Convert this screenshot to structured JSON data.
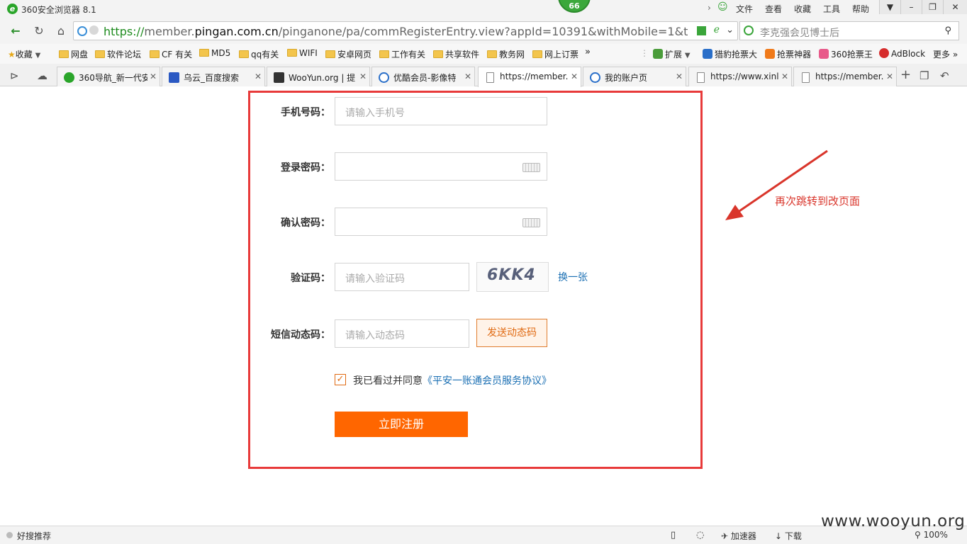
{
  "window": {
    "title": "360安全浏览器 8.1",
    "badge": "66",
    "menus": [
      "文件",
      "查看",
      "收藏",
      "工具",
      "帮助"
    ]
  },
  "address": {
    "url_scheme": "https://",
    "url_sub": "member.",
    "url_domain": "pingan.com.cn",
    "url_path": "/pinganone/pa/commRegisterEntry.view?appId=10391&withMobile=1&timestam",
    "search_text": "李克强会见博士后"
  },
  "bookmarks": {
    "left": [
      {
        "label": "收藏"
      },
      {
        "label": "网盘"
      },
      {
        "label": "软件论坛"
      },
      {
        "label": "CF 有关"
      },
      {
        "label": "MD5"
      },
      {
        "label": "qq有关"
      },
      {
        "label": "WIFI"
      },
      {
        "label": "安卓网页"
      },
      {
        "label": "工作有关"
      },
      {
        "label": "共享软件"
      },
      {
        "label": "教务网"
      },
      {
        "label": "网上订票"
      }
    ],
    "more_left": "»",
    "extensions": "扩展",
    "right": [
      {
        "label": "猎豹抢票大",
        "color": "#2a6fc9"
      },
      {
        "label": "抢票神器",
        "color": "#f07a1a"
      },
      {
        "label": "360抢票王",
        "color": "#e85a8a"
      },
      {
        "label": "AdBlock",
        "color": "#d62c2c"
      }
    ],
    "more_right": "更多"
  },
  "tabs": [
    {
      "label": "360导航_新一代安",
      "color": "#2aa52a"
    },
    {
      "label": "乌云_百度搜索",
      "color": "#2b59c3"
    },
    {
      "label": "WooYun.org | 提",
      "color": "#333333"
    },
    {
      "label": "优酷会员-影像特",
      "color": "#2a6fc9"
    },
    {
      "label": "https://member.",
      "color": "#ffffff"
    },
    {
      "label": "我的账户页",
      "color": "#2a6fc9"
    },
    {
      "label": "https://www.xinl",
      "color": "#ffffff"
    },
    {
      "label": "https://member.",
      "color": "#ffffff"
    }
  ],
  "form": {
    "phone_label": "手机号码：",
    "phone_placeholder": "请输入手机号",
    "password_label": "登录密码：",
    "confirm_label": "确认密码：",
    "captcha_label": "验证码：",
    "captcha_placeholder": "请输入验证码",
    "captcha_text": "6KK4",
    "captcha_refresh": "换一张",
    "sms_label": "短信动态码：",
    "sms_placeholder": "请输入动态码",
    "sms_button": "发送动态码",
    "agree_prefix": "我已看过并同意",
    "agree_link": "《平安一账通会员服务协议》",
    "agree_checked": true,
    "submit": "立即注册"
  },
  "annotation": {
    "note": "再次跳转到改页面"
  },
  "statusbar": {
    "left": "好搜推荐",
    "accelerator": "加速器",
    "download": "下载",
    "zoom": "100%"
  },
  "watermark": "www.wooyun.org",
  "colors": {
    "accent": "#ff6600",
    "frame": "#e83a3a",
    "link": "#1a6fb3"
  }
}
